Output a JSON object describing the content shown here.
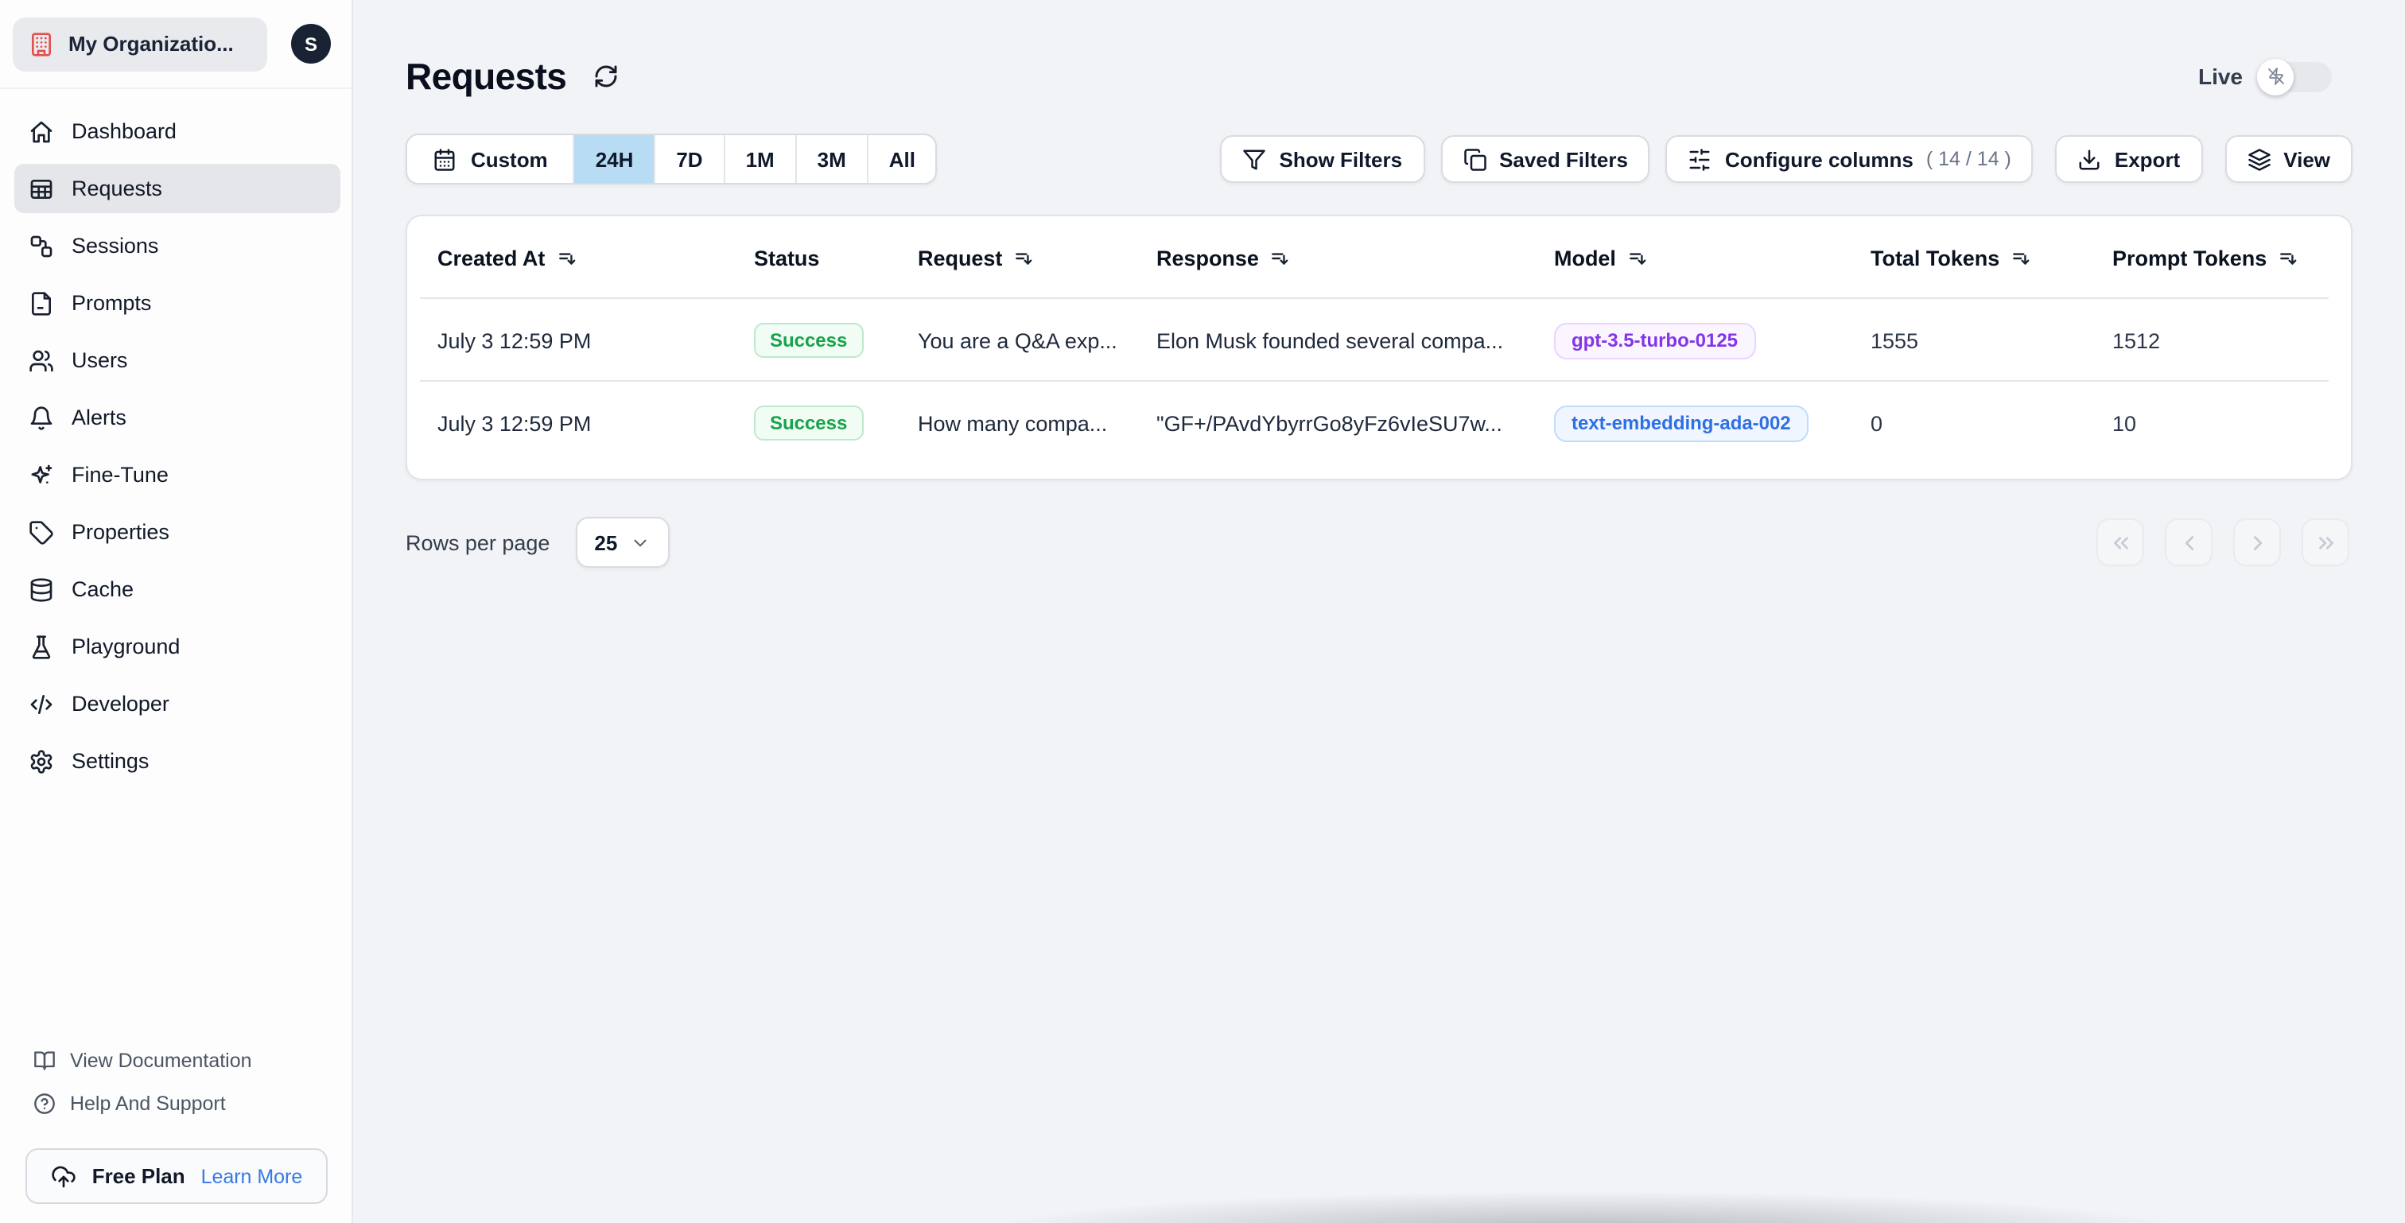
{
  "org": {
    "name": "My Organizatio...",
    "avatar_initial": "S"
  },
  "sidebar": {
    "items": [
      {
        "label": "Dashboard"
      },
      {
        "label": "Requests"
      },
      {
        "label": "Sessions"
      },
      {
        "label": "Prompts"
      },
      {
        "label": "Users"
      },
      {
        "label": "Alerts"
      },
      {
        "label": "Fine-Tune"
      },
      {
        "label": "Properties"
      },
      {
        "label": "Cache"
      },
      {
        "label": "Playground"
      },
      {
        "label": "Developer"
      },
      {
        "label": "Settings"
      }
    ],
    "active_item": "Requests",
    "footer": {
      "docs_label": "View Documentation",
      "help_label": "Help And Support",
      "plan_label": "Free Plan",
      "plan_action": "Learn More"
    }
  },
  "header": {
    "title": "Requests",
    "live_label": "Live",
    "live_enabled": false
  },
  "time_range": {
    "custom_label": "Custom",
    "options": [
      {
        "label": "24H"
      },
      {
        "label": "7D"
      },
      {
        "label": "1M"
      },
      {
        "label": "3M"
      },
      {
        "label": "All"
      }
    ],
    "selected": "24H"
  },
  "toolbar": {
    "show_filters_label": "Show Filters",
    "saved_filters_label": "Saved Filters",
    "configure_columns_label": "Configure columns",
    "configure_columns_count": "( 14 / 14 )",
    "export_label": "Export",
    "view_label": "View"
  },
  "table": {
    "columns": [
      {
        "label": "Created At",
        "sortable": true
      },
      {
        "label": "Status",
        "sortable": false
      },
      {
        "label": "Request",
        "sortable": true
      },
      {
        "label": "Response",
        "sortable": true
      },
      {
        "label": "Model",
        "sortable": true
      },
      {
        "label": "Total Tokens",
        "sortable": true
      },
      {
        "label": "Prompt Tokens",
        "sortable": true
      }
    ],
    "rows": [
      {
        "created_at": "July 3 12:59 PM",
        "status": "Success",
        "request": "You are a Q&A exp...",
        "response": "Elon Musk founded several compa...",
        "model": "gpt-3.5-turbo-0125",
        "model_color": "purple",
        "total_tokens": "1555",
        "prompt_tokens": "1512"
      },
      {
        "created_at": "July 3 12:59 PM",
        "status": "Success",
        "request": "How many compa...",
        "response": "\"GF+/PAvdYbyrrGo8yFz6vIeSU7w...",
        "model": "text-embedding-ada-002",
        "model_color": "blue",
        "total_tokens": "0",
        "prompt_tokens": "10"
      }
    ]
  },
  "pagination": {
    "rows_per_page_label": "Rows per page",
    "rows_per_page_value": "25"
  },
  "colors": {
    "selected_range_bg": "#b8dcf3",
    "success_text": "#16a34a",
    "model_purple": "#8336e6",
    "model_blue": "#2f6fe4",
    "link_blue": "#3779e3",
    "org_icon_red": "#e4504e"
  }
}
